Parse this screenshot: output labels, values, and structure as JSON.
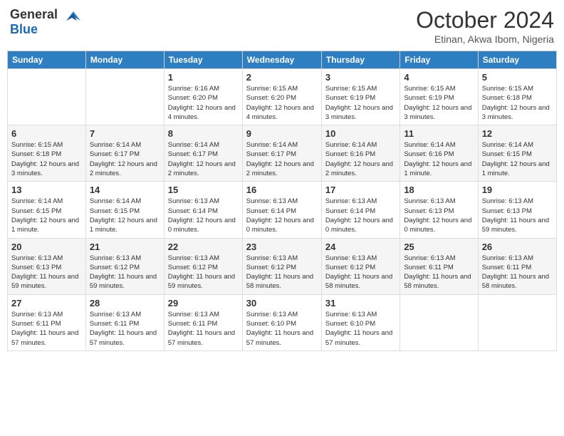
{
  "logo": {
    "general": "General",
    "blue": "Blue"
  },
  "title": "October 2024",
  "subtitle": "Etinan, Akwa Ibom, Nigeria",
  "days_of_week": [
    "Sunday",
    "Monday",
    "Tuesday",
    "Wednesday",
    "Thursday",
    "Friday",
    "Saturday"
  ],
  "weeks": [
    [
      {
        "day": "",
        "info": ""
      },
      {
        "day": "",
        "info": ""
      },
      {
        "day": "1",
        "info": "Sunrise: 6:16 AM\nSunset: 6:20 PM\nDaylight: 12 hours and 4 minutes."
      },
      {
        "day": "2",
        "info": "Sunrise: 6:15 AM\nSunset: 6:20 PM\nDaylight: 12 hours and 4 minutes."
      },
      {
        "day": "3",
        "info": "Sunrise: 6:15 AM\nSunset: 6:19 PM\nDaylight: 12 hours and 3 minutes."
      },
      {
        "day": "4",
        "info": "Sunrise: 6:15 AM\nSunset: 6:19 PM\nDaylight: 12 hours and 3 minutes."
      },
      {
        "day": "5",
        "info": "Sunrise: 6:15 AM\nSunset: 6:18 PM\nDaylight: 12 hours and 3 minutes."
      }
    ],
    [
      {
        "day": "6",
        "info": "Sunrise: 6:15 AM\nSunset: 6:18 PM\nDaylight: 12 hours and 3 minutes."
      },
      {
        "day": "7",
        "info": "Sunrise: 6:14 AM\nSunset: 6:17 PM\nDaylight: 12 hours and 2 minutes."
      },
      {
        "day": "8",
        "info": "Sunrise: 6:14 AM\nSunset: 6:17 PM\nDaylight: 12 hours and 2 minutes."
      },
      {
        "day": "9",
        "info": "Sunrise: 6:14 AM\nSunset: 6:17 PM\nDaylight: 12 hours and 2 minutes."
      },
      {
        "day": "10",
        "info": "Sunrise: 6:14 AM\nSunset: 6:16 PM\nDaylight: 12 hours and 2 minutes."
      },
      {
        "day": "11",
        "info": "Sunrise: 6:14 AM\nSunset: 6:16 PM\nDaylight: 12 hours and 1 minute."
      },
      {
        "day": "12",
        "info": "Sunrise: 6:14 AM\nSunset: 6:15 PM\nDaylight: 12 hours and 1 minute."
      }
    ],
    [
      {
        "day": "13",
        "info": "Sunrise: 6:14 AM\nSunset: 6:15 PM\nDaylight: 12 hours and 1 minute."
      },
      {
        "day": "14",
        "info": "Sunrise: 6:14 AM\nSunset: 6:15 PM\nDaylight: 12 hours and 1 minute."
      },
      {
        "day": "15",
        "info": "Sunrise: 6:13 AM\nSunset: 6:14 PM\nDaylight: 12 hours and 0 minutes."
      },
      {
        "day": "16",
        "info": "Sunrise: 6:13 AM\nSunset: 6:14 PM\nDaylight: 12 hours and 0 minutes."
      },
      {
        "day": "17",
        "info": "Sunrise: 6:13 AM\nSunset: 6:14 PM\nDaylight: 12 hours and 0 minutes."
      },
      {
        "day": "18",
        "info": "Sunrise: 6:13 AM\nSunset: 6:13 PM\nDaylight: 12 hours and 0 minutes."
      },
      {
        "day": "19",
        "info": "Sunrise: 6:13 AM\nSunset: 6:13 PM\nDaylight: 11 hours and 59 minutes."
      }
    ],
    [
      {
        "day": "20",
        "info": "Sunrise: 6:13 AM\nSunset: 6:13 PM\nDaylight: 11 hours and 59 minutes."
      },
      {
        "day": "21",
        "info": "Sunrise: 6:13 AM\nSunset: 6:12 PM\nDaylight: 11 hours and 59 minutes."
      },
      {
        "day": "22",
        "info": "Sunrise: 6:13 AM\nSunset: 6:12 PM\nDaylight: 11 hours and 59 minutes."
      },
      {
        "day": "23",
        "info": "Sunrise: 6:13 AM\nSunset: 6:12 PM\nDaylight: 11 hours and 58 minutes."
      },
      {
        "day": "24",
        "info": "Sunrise: 6:13 AM\nSunset: 6:12 PM\nDaylight: 11 hours and 58 minutes."
      },
      {
        "day": "25",
        "info": "Sunrise: 6:13 AM\nSunset: 6:11 PM\nDaylight: 11 hours and 58 minutes."
      },
      {
        "day": "26",
        "info": "Sunrise: 6:13 AM\nSunset: 6:11 PM\nDaylight: 11 hours and 58 minutes."
      }
    ],
    [
      {
        "day": "27",
        "info": "Sunrise: 6:13 AM\nSunset: 6:11 PM\nDaylight: 11 hours and 57 minutes."
      },
      {
        "day": "28",
        "info": "Sunrise: 6:13 AM\nSunset: 6:11 PM\nDaylight: 11 hours and 57 minutes."
      },
      {
        "day": "29",
        "info": "Sunrise: 6:13 AM\nSunset: 6:11 PM\nDaylight: 11 hours and 57 minutes."
      },
      {
        "day": "30",
        "info": "Sunrise: 6:13 AM\nSunset: 6:10 PM\nDaylight: 11 hours and 57 minutes."
      },
      {
        "day": "31",
        "info": "Sunrise: 6:13 AM\nSunset: 6:10 PM\nDaylight: 11 hours and 57 minutes."
      },
      {
        "day": "",
        "info": ""
      },
      {
        "day": "",
        "info": ""
      }
    ]
  ]
}
